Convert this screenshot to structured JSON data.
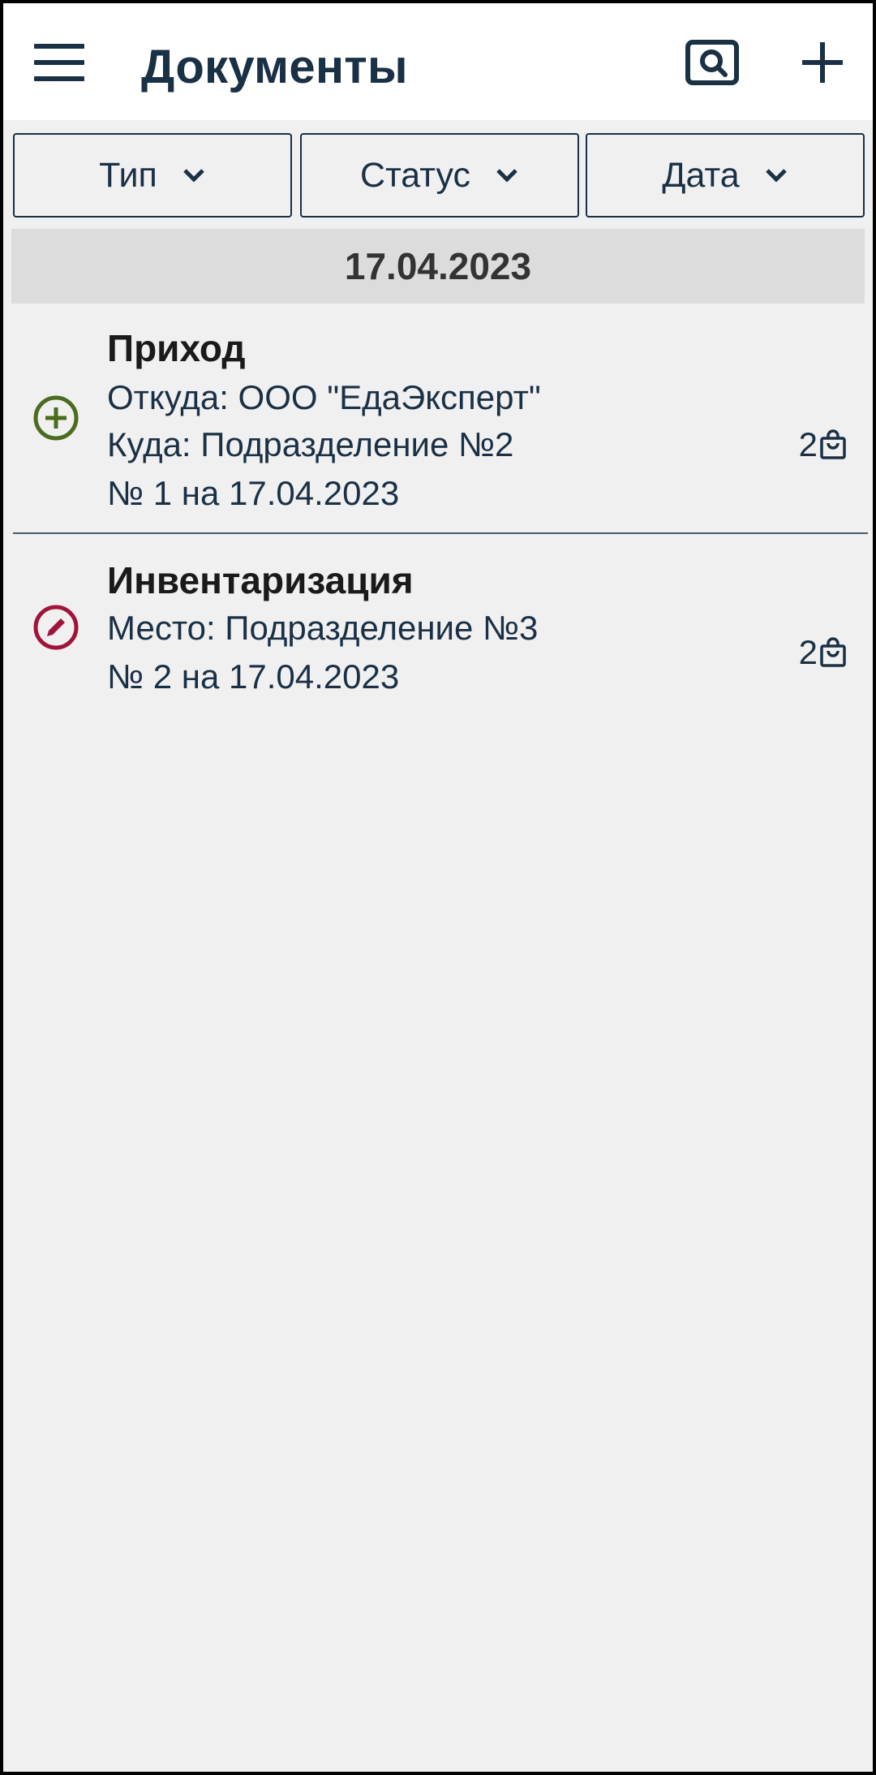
{
  "header": {
    "title": "Документы",
    "menu_icon": "hamburger-menu-icon",
    "scan_icon": "scan-search-icon",
    "add_icon": "plus-icon"
  },
  "filters": [
    {
      "label": "Тип"
    },
    {
      "label": "Статус"
    },
    {
      "label": "Дата"
    }
  ],
  "date_group": "17.04.2023",
  "documents": [
    {
      "type": "Приход",
      "status_icon": "add-circle-icon",
      "status_color": "#4b6b1e",
      "lines": [
        "Откуда: ООО \"ЕдаЭксперт\"",
        "Куда: Подразделение №2",
        "№ 1 на 17.04.2023"
      ],
      "count": "2"
    },
    {
      "type": "Инвентаризация",
      "status_icon": "edit-circle-icon",
      "status_color": "#a0143c",
      "lines": [
        "Место: Подразделение №3",
        "№ 2 на 17.04.2023"
      ],
      "count": "2"
    }
  ],
  "colors": {
    "primary_text": "#1a3045",
    "background": "#f0f0f0",
    "date_header_bg": "#dcdcdc"
  }
}
